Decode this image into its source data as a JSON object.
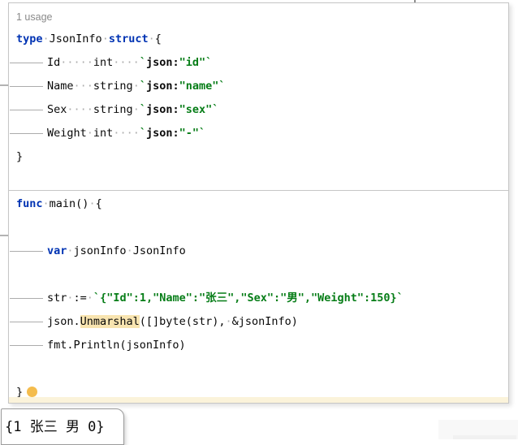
{
  "editor": {
    "usage_hint": "1 usage",
    "language": "go",
    "lines": [
      {
        "ind": false,
        "seg": [
          [
            "kw",
            "type"
          ],
          [
            "ws",
            1
          ],
          [
            "pl",
            "JsonInfo"
          ],
          [
            "ws",
            1
          ],
          [
            "kw",
            "struct"
          ],
          [
            "ws",
            1
          ],
          [
            "pl",
            "{"
          ]
        ]
      },
      {
        "ind": true,
        "seg": [
          [
            "pl",
            "Id"
          ],
          [
            "ws",
            5
          ],
          [
            "pl",
            "int"
          ],
          [
            "ws",
            4
          ],
          [
            "st",
            "`"
          ],
          [
            "tk",
            "json:"
          ],
          [
            "st",
            "\"id\""
          ],
          [
            "st",
            "`"
          ]
        ]
      },
      {
        "ind": true,
        "seg": [
          [
            "pl",
            "Name"
          ],
          [
            "ws",
            3
          ],
          [
            "pl",
            "string"
          ],
          [
            "ws",
            1
          ],
          [
            "st",
            "`"
          ],
          [
            "tk",
            "json:"
          ],
          [
            "st",
            "\"name\""
          ],
          [
            "st",
            "`"
          ]
        ]
      },
      {
        "ind": true,
        "seg": [
          [
            "pl",
            "Sex"
          ],
          [
            "ws",
            4
          ],
          [
            "pl",
            "string"
          ],
          [
            "ws",
            1
          ],
          [
            "st",
            "`"
          ],
          [
            "tk",
            "json:"
          ],
          [
            "st",
            "\"sex\""
          ],
          [
            "st",
            "`"
          ]
        ]
      },
      {
        "ind": true,
        "seg": [
          [
            "pl",
            "Weight"
          ],
          [
            "ws",
            1
          ],
          [
            "pl",
            "int"
          ],
          [
            "ws",
            4
          ],
          [
            "st",
            "`"
          ],
          [
            "tk",
            "json:"
          ],
          [
            "st",
            "\"-\""
          ],
          [
            "st",
            "`"
          ]
        ]
      },
      {
        "ind": false,
        "seg": [
          [
            "pl",
            "}"
          ]
        ]
      },
      {
        "ind": false,
        "seg": []
      },
      {
        "ind": false,
        "seg": [
          [
            "kw",
            "func"
          ],
          [
            "ws",
            1
          ],
          [
            "pl",
            "main()"
          ],
          [
            "ws",
            1
          ],
          [
            "pl",
            "{"
          ]
        ]
      },
      {
        "ind": false,
        "seg": []
      },
      {
        "ind": true,
        "seg": [
          [
            "kw",
            "var"
          ],
          [
            "ws",
            1
          ],
          [
            "pl",
            "jsonInfo"
          ],
          [
            "ws",
            1
          ],
          [
            "pl",
            "JsonInfo"
          ]
        ]
      },
      {
        "ind": false,
        "seg": []
      },
      {
        "ind": true,
        "seg": [
          [
            "pl",
            "str"
          ],
          [
            "ws",
            1
          ],
          [
            "pl",
            ":="
          ],
          [
            "ws",
            1
          ],
          [
            "st",
            "`{\"Id\":1,\"Name\":\"张三\",\"Sex\":\"男\",\"Weight\":150}`"
          ]
        ]
      },
      {
        "ind": true,
        "seg": [
          [
            "pl",
            "json."
          ],
          [
            "hl",
            "Unmarshal"
          ],
          [
            "pl",
            "([]byte(str),"
          ],
          [
            "ws",
            1
          ],
          [
            "pl",
            "&jsonInfo)"
          ]
        ]
      },
      {
        "ind": true,
        "seg": [
          [
            "pl",
            "fmt.Println(jsonInfo)"
          ]
        ]
      },
      {
        "ind": false,
        "seg": []
      },
      {
        "ind": false,
        "seg": [
          [
            "pl",
            "}"
          ]
        ],
        "bulb": true
      }
    ],
    "icons": {
      "bulb": "intention-lightbulb-icon"
    }
  },
  "output_popup": {
    "text": "{1 张三 男 0}"
  },
  "colors": {
    "keyword": "#0033B3",
    "string": "#067D17",
    "identifier_highlight": "#F8E4B0",
    "caret_row": "#FBF3DA",
    "whitespace_marks": "#ACACAC",
    "bulb": "#F4BC4D",
    "panel_border": "#C6C6C6"
  }
}
